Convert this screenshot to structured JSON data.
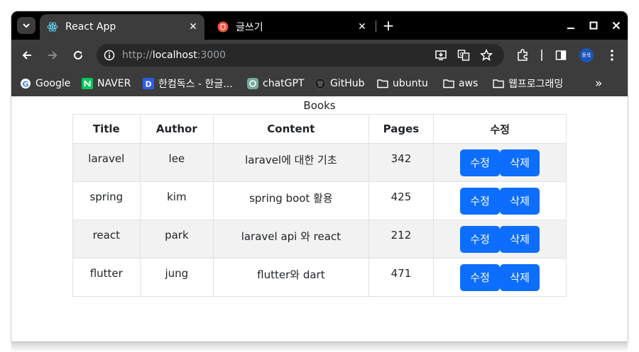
{
  "browser": {
    "tabs": [
      {
        "title": "React App",
        "icon": "react-icon",
        "active": true
      },
      {
        "title": "글쓰기",
        "icon": "laravel-icon",
        "active": false
      }
    ],
    "url": {
      "scheme": "http://",
      "host": "localhost",
      "port": ":3000"
    },
    "profile_avatar": "동욱",
    "bookmarks": [
      {
        "label": "Google",
        "icon": "google-icon"
      },
      {
        "label": "NAVER",
        "icon": "naver-icon"
      },
      {
        "label": "한컴독스 - 한글...",
        "icon": "hancom-docs-icon"
      },
      {
        "label": "chatGPT",
        "icon": "chatgpt-icon"
      },
      {
        "label": "GitHub",
        "icon": "github-icon"
      },
      {
        "label": "ubuntu",
        "icon": "folder-icon"
      },
      {
        "label": "aws",
        "icon": "folder-icon"
      },
      {
        "label": "웹프로그래밍",
        "icon": "folder-icon"
      }
    ],
    "more_bookmarks": "»"
  },
  "page": {
    "caption": "Books",
    "columns": [
      "Title",
      "Author",
      "Content",
      "Pages",
      "수정"
    ],
    "rows": [
      {
        "title": "laravel",
        "author": "lee",
        "content": "laravel에 대한 기초",
        "pages": "342"
      },
      {
        "title": "spring",
        "author": "kim",
        "content": "spring boot 활용",
        "pages": "425"
      },
      {
        "title": "react",
        "author": "park",
        "content": "laravel api 와 react",
        "pages": "212"
      },
      {
        "title": "flutter",
        "author": "jung",
        "content": "flutter와 dart",
        "pages": "471"
      }
    ],
    "edit_label": "수정",
    "delete_label": "삭제"
  },
  "colors": {
    "accent": "#0d6efd",
    "stripe": "#f2f2f2",
    "chrome_dark": "#3c3c3c"
  }
}
